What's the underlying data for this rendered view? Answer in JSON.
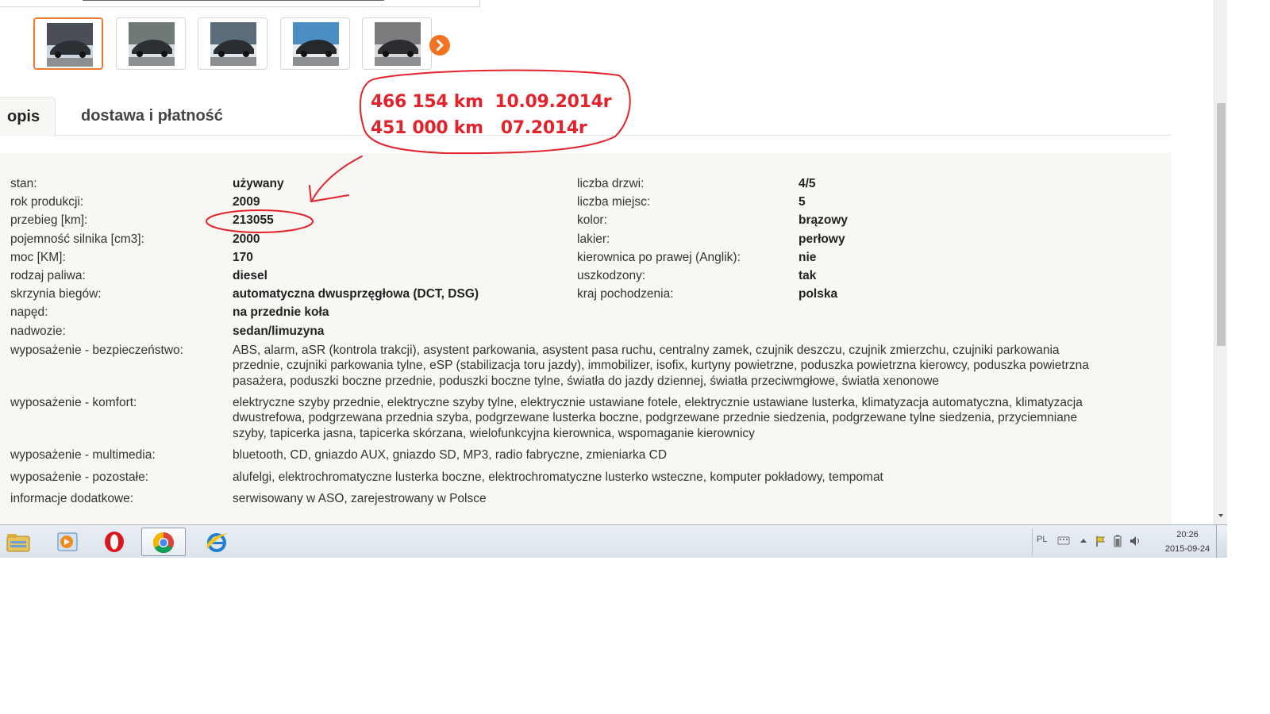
{
  "thumbnails": [
    {
      "alt": "car-photo-1",
      "active": true
    },
    {
      "alt": "car-photo-2",
      "active": false
    },
    {
      "alt": "car-photo-3",
      "active": false
    },
    {
      "alt": "car-photo-4",
      "active": false
    },
    {
      "alt": "car-photo-5",
      "active": false
    }
  ],
  "tabs": {
    "opis": "opis",
    "dostawa": "dostawa i płatność"
  },
  "details_left": [
    {
      "label": "stan:",
      "value": "używany"
    },
    {
      "label": "rok produkcji:",
      "value": "2009"
    },
    {
      "label": "przebieg [km]:",
      "value": "213055"
    },
    {
      "label": "pojemność silnika [cm3]:",
      "value": "2000"
    },
    {
      "label": "moc [KM]:",
      "value": "170"
    },
    {
      "label": "rodzaj paliwa:",
      "value": "diesel"
    },
    {
      "label": "skrzynia biegów:",
      "value": "automatyczna dwusprzęgłowa (DCT, DSG)"
    },
    {
      "label": "napęd:",
      "value": "na przednie koła"
    },
    {
      "label": "nadwozie:",
      "value": "sedan/limuzyna"
    }
  ],
  "details_right": [
    {
      "label": "liczba drzwi:",
      "value": "4/5"
    },
    {
      "label": "liczba miejsc:",
      "value": "5"
    },
    {
      "label": "kolor:",
      "value": "brązowy"
    },
    {
      "label": "lakier:",
      "value": "perłowy"
    },
    {
      "label": "kierownica po prawej (Anglik):",
      "value": "nie"
    },
    {
      "label": "uszkodzony:",
      "value": "tak"
    },
    {
      "label": "kraj pochodzenia:",
      "value": "polska"
    }
  ],
  "equipment": [
    {
      "label": "wyposażenie - bezpieczeństwo:",
      "lines": [
        "ABS, alarm, aSR (kontrola trakcji), asystent parkowania, asystent pasa ruchu, centralny zamek, czujnik deszczu, czujnik zmierzchu, czujniki parkowania",
        "przednie, czujniki parkowania tylne, eSP (stabilizacja toru jazdy), immobilizer, isofix, kurtyny powietrzne, poduszka powietrzna kierowcy, poduszka powietrzna",
        "pasażera, poduszki boczne przednie, poduszki boczne tylne, światła do jazdy dziennej, światła przeciwmgłowe, światła xenonowe"
      ]
    },
    {
      "label": "wyposażenie - komfort:",
      "lines": [
        "elektryczne szyby przednie, elektryczne szyby tylne, elektrycznie ustawiane fotele, elektrycznie ustawiane lusterka, klimatyzacja automatyczna, klimatyzacja",
        "dwustrefowa, podgrzewana przednia szyba, podgrzewane lusterka boczne, podgrzewane przednie siedzenia, podgrzewane tylne siedzenia, przyciemniane",
        "szyby, tapicerka jasna, tapicerka skórzana, wielofunkcyjna kierownica, wspomaganie kierownicy"
      ]
    },
    {
      "label": "wyposażenie - multimedia:",
      "lines": [
        "bluetooth, CD, gniazdo AUX, gniazdo SD, MP3, radio fabryczne, zmieniarka CD"
      ]
    },
    {
      "label": "wyposażenie - pozostałe:",
      "lines": [
        "alufelgi, elektrochromatyczne lusterka boczne, elektrochromatyczne lusterko wsteczne, komputer pokładowy, tempomat"
      ]
    },
    {
      "label": "informacje dodatkowe:",
      "lines": [
        "serwisowany w ASO, zarejestrowany w Polsce"
      ]
    }
  ],
  "annotation": {
    "line1": "466 154 km  10.09.2014r",
    "line2": "451 000 km   07.2014r",
    "color": "#e3232b"
  },
  "taskbar": {
    "apps": [
      "file-explorer-icon",
      "media-player-icon",
      "opera-icon",
      "chrome-icon",
      "internet-explorer-icon"
    ],
    "active_app": "chrome-icon",
    "language": "PL",
    "time": "20:26",
    "date": "2015-09-24"
  },
  "colors": {
    "accent": "#f47320",
    "panel_bg": "#f8f7f3",
    "annotation": "#e3232b"
  }
}
